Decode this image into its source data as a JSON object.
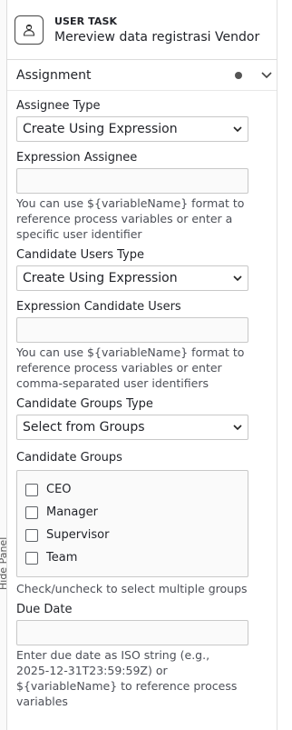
{
  "side_tab": {
    "label": "Hide Panel"
  },
  "header": {
    "type_label": "USER TASK",
    "task_name": "Mereview data registrasi Vendor",
    "icon": "user-task-icon"
  },
  "group": {
    "title": "Assignment",
    "icons": [
      "status-dot-icon",
      "chevron-down-icon"
    ]
  },
  "fields": {
    "assignee_type": {
      "label": "Assignee Type",
      "value": "Create Using Expression"
    },
    "expression_assignee": {
      "label": "Expression Assignee",
      "value": "",
      "desc": [
        "You can use ${variableName} format to",
        "reference process variables or enter a",
        "specific user identifier"
      ]
    },
    "candidate_users_type": {
      "label": "Candidate Users Type",
      "value": "Create Using Expression"
    },
    "expression_candidate_users": {
      "label": "Expression Candidate Users",
      "value": "",
      "desc": [
        "You can use ${variableName} format to",
        "reference process variables or enter",
        "comma-separated user identifiers"
      ]
    },
    "candidate_groups_type": {
      "label": "Candidate Groups Type",
      "value": "Select from Groups"
    },
    "candidate_groups": {
      "label": "Candidate Groups",
      "options": [
        "CEO",
        "Manager",
        "Supervisor",
        "Team"
      ],
      "desc": [
        "Check/uncheck to select multiple groups"
      ]
    },
    "due_date": {
      "label": "Due Date",
      "value": "",
      "desc": [
        "Enter due date as ISO string (e.g.,",
        "2025-12-31T23:59:59Z) or",
        "${variableName} to reference process",
        "variables"
      ]
    }
  }
}
